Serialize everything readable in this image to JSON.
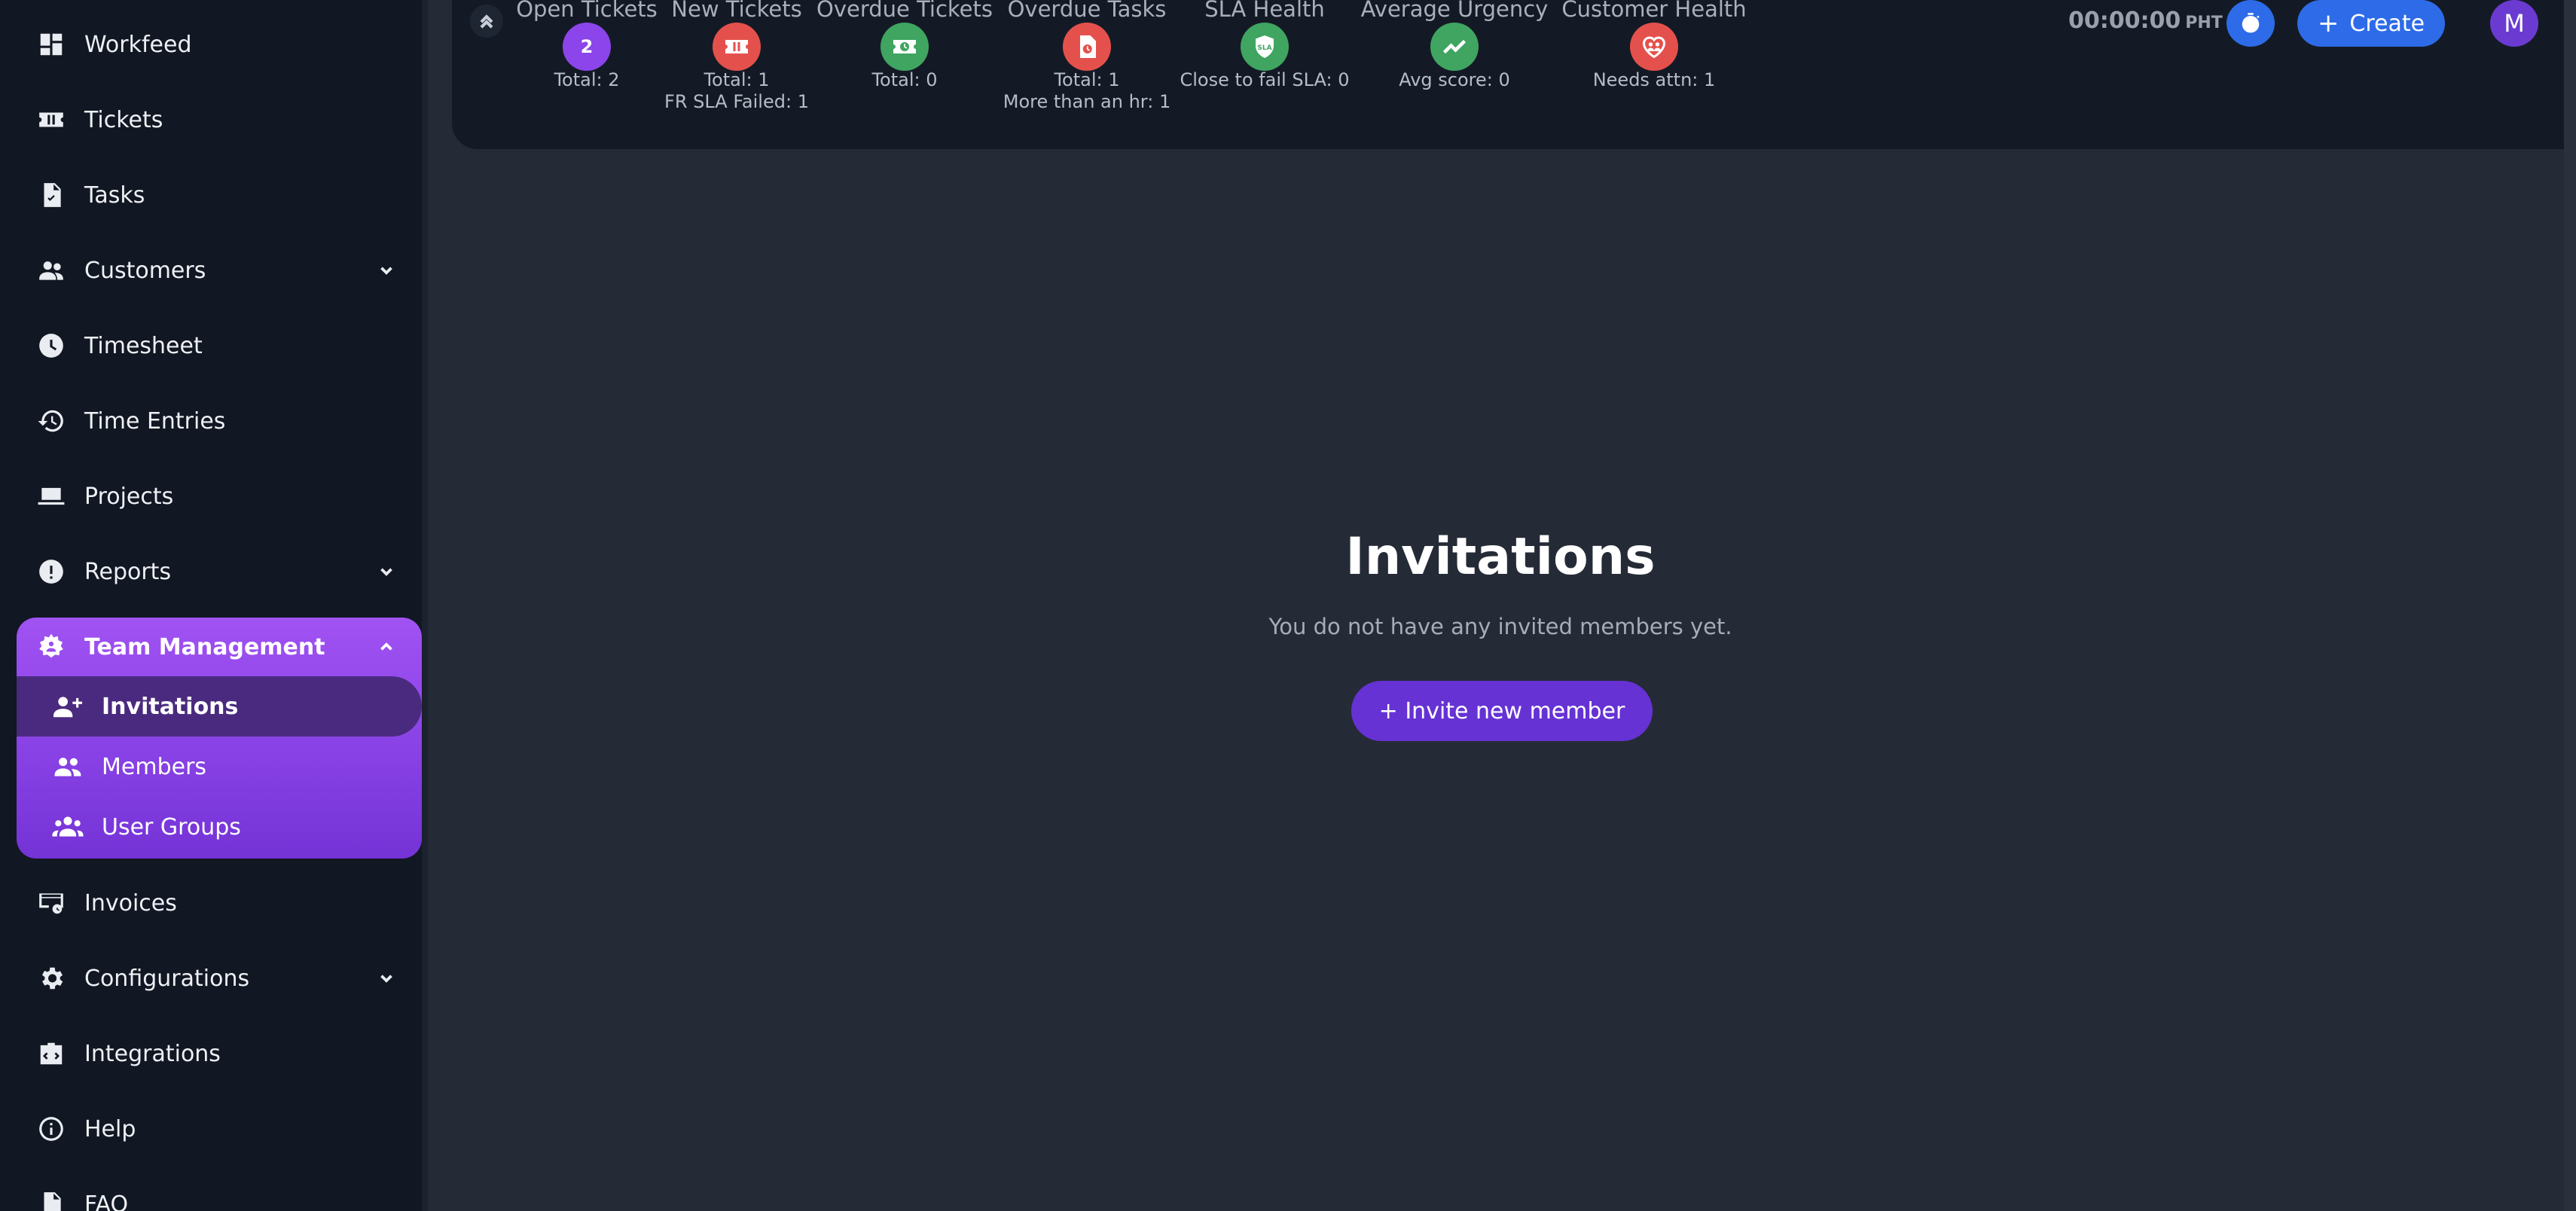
{
  "sidebar": {
    "items": [
      {
        "id": "workfeed",
        "label": "Workfeed",
        "icon": "dashboard-icon"
      },
      {
        "id": "tickets",
        "label": "Tickets",
        "icon": "ticket-icon"
      },
      {
        "id": "tasks",
        "label": "Tasks",
        "icon": "task-file-icon"
      },
      {
        "id": "customers",
        "label": "Customers",
        "icon": "people-icon",
        "expandable": true
      },
      {
        "id": "timesheet",
        "label": "Timesheet",
        "icon": "clock-icon"
      },
      {
        "id": "time-entries",
        "label": "Time Entries",
        "icon": "history-icon"
      },
      {
        "id": "projects",
        "label": "Projects",
        "icon": "laptop-icon"
      },
      {
        "id": "reports",
        "label": "Reports",
        "icon": "alert-icon",
        "expandable": true
      },
      {
        "id": "invoices",
        "label": "Invoices",
        "icon": "invoice-icon"
      },
      {
        "id": "configurations",
        "label": "Configurations",
        "icon": "gear-icon",
        "expandable": true
      },
      {
        "id": "integrations",
        "label": "Integrations",
        "icon": "integration-icon"
      },
      {
        "id": "help",
        "label": "Help",
        "icon": "info-icon"
      },
      {
        "id": "faq",
        "label": "FAQ",
        "icon": "faq-icon"
      }
    ],
    "team_group": {
      "label": "Team Management",
      "icon": "team-settings-icon",
      "expanded": true,
      "children": [
        {
          "id": "invitations",
          "label": "Invitations",
          "icon": "person-add-icon",
          "active": true
        },
        {
          "id": "members",
          "label": "Members",
          "icon": "members-icon",
          "active": false
        },
        {
          "id": "user-groups",
          "label": "User Groups",
          "icon": "groups-icon",
          "active": false
        }
      ]
    }
  },
  "header": {
    "stats": [
      {
        "title": "Open Tickets",
        "badge": "2",
        "color": "#8b45ea",
        "line1": "Total: 2",
        "line2": ""
      },
      {
        "title": "New Tickets",
        "badge": "",
        "icon": "ticket-icon",
        "color": "#e4514d",
        "line1": "Total: 1",
        "line2": "FR SLA Failed: 1"
      },
      {
        "title": "Overdue Tickets",
        "badge": "",
        "icon": "ticket-clock-icon",
        "color": "#3fa561",
        "line1": "Total: 0",
        "line2": ""
      },
      {
        "title": "Overdue Tasks",
        "badge": "",
        "icon": "task-clock-icon",
        "color": "#e4514d",
        "line1": "Total: 1",
        "line2": "More than an hr: 1"
      },
      {
        "title": "SLA Health",
        "badge": "",
        "icon": "sla-shield-icon",
        "color": "#3fa561",
        "line1": "Close to fail SLA: 0",
        "line2": ""
      },
      {
        "title": "Average Urgency",
        "badge": "",
        "icon": "trend-up-icon",
        "color": "#3fa561",
        "line1": "Avg score: 0",
        "line2": ""
      },
      {
        "title": "Customer Health",
        "badge": "",
        "icon": "customer-health-icon",
        "color": "#e4514d",
        "line1": "Needs attn: 1",
        "line2": ""
      }
    ],
    "clock": {
      "time": "00:00:00",
      "tz": "PHT"
    },
    "create_label": "Create",
    "avatar_initial": "M"
  },
  "main": {
    "title": "Invitations",
    "subtitle": "You do not have any invited members yet.",
    "invite_label": "+ Invite new member"
  },
  "colors": {
    "accent": "#6632d4",
    "primary_blue": "#2d6be8",
    "sidebar_bg": "#111723",
    "content_bg": "#252b36"
  }
}
